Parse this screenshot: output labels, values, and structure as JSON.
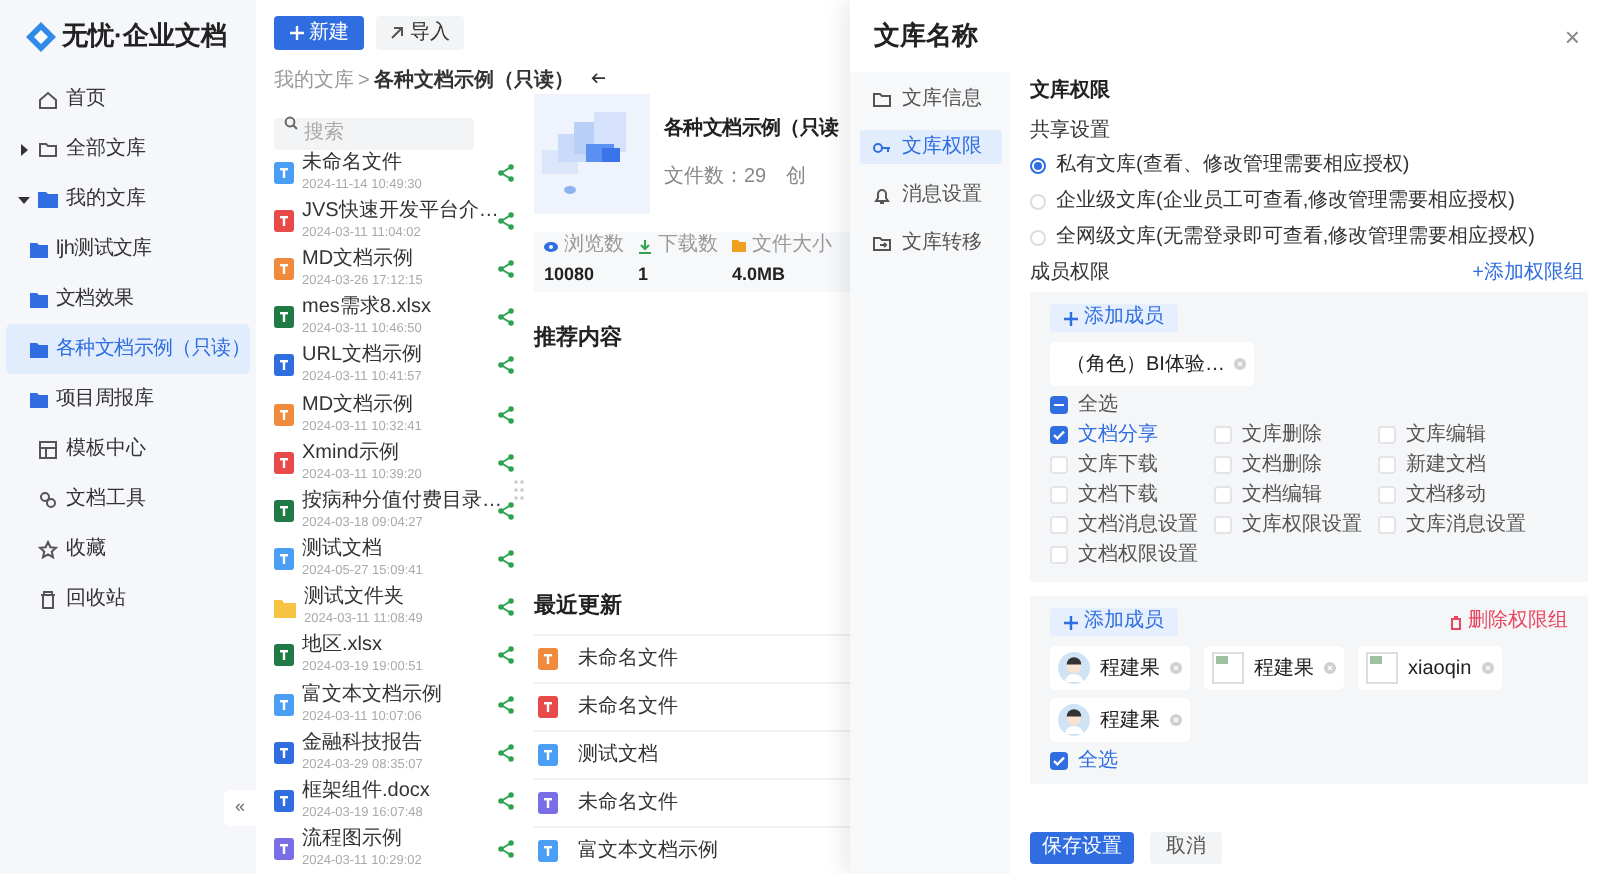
{
  "brand": {
    "name": "无忧·企业文档"
  },
  "sidebar": {
    "items": [
      {
        "label": "首页",
        "selected": false
      },
      {
        "label": "全部文库",
        "selected": false,
        "expanded": false
      },
      {
        "label": "我的文库",
        "selected": false,
        "expanded": true,
        "children": [
          {
            "label": "ljh测试文库",
            "selected": false
          },
          {
            "label": "文档效果",
            "selected": false
          },
          {
            "label": "各种文档示例（只读）",
            "selected": true
          },
          {
            "label": "项目周报库",
            "selected": false
          }
        ]
      },
      {
        "label": "模板中心",
        "selected": false
      },
      {
        "label": "文档工具",
        "selected": false
      },
      {
        "label": "收藏",
        "selected": false
      },
      {
        "label": "回收站",
        "selected": false
      }
    ],
    "collapse": "«"
  },
  "toolbar": {
    "new_button": "新建",
    "import_button": "导入"
  },
  "breadcrumb": {
    "parent": "我的文库",
    "separator": ">",
    "current": "各种文档示例（只读）"
  },
  "search": {
    "placeholder": "搜索"
  },
  "files": [
    {
      "kind": "doc",
      "name": "未命名文件",
      "time": "2024-11-14 10:49:30"
    },
    {
      "kind": "pdf",
      "name": "JVS快速开发平台介…",
      "time": "2024-03-11 11:04:02"
    },
    {
      "kind": "md",
      "name": "MD文档示例",
      "time": "2024-03-26 17:12:15"
    },
    {
      "kind": "excel",
      "name": "mes需求8.xlsx",
      "time": "2024-03-11 10:46:50"
    },
    {
      "kind": "url",
      "name": "URL文档示例",
      "time": "2024-03-11 10:41:57"
    },
    {
      "kind": "md",
      "name": "MD文档示例",
      "time": "2024-03-11 10:32:41"
    },
    {
      "kind": "xmind",
      "name": "Xmind示例",
      "time": "2024-03-11 10:39:20"
    },
    {
      "kind": "excel",
      "name": "按病种分值付费目录…",
      "time": "2024-03-18 09:04:27"
    },
    {
      "kind": "doc",
      "name": "测试文档",
      "time": "2024-05-27 15:09:41"
    },
    {
      "kind": "folder",
      "name": "测试文件夹",
      "time": "2024-03-11 11:08:49"
    },
    {
      "kind": "excel",
      "name": "地区.xlsx",
      "time": "2024-03-19 19:00:51"
    },
    {
      "kind": "doc",
      "name": "富文本文档示例",
      "time": "2024-03-11 10:07:06"
    },
    {
      "kind": "url",
      "name": "金融科技报告",
      "time": "2024-03-29 08:35:07"
    },
    {
      "kind": "word",
      "name": "框架组件.docx",
      "time": "2024-03-19 16:07:48"
    },
    {
      "kind": "flow",
      "name": "流程图示例",
      "time": "2024-03-11 10:29:02"
    }
  ],
  "library": {
    "title": "各种文档示例（只读",
    "file_count": "文件数：29",
    "created": "创",
    "stats": [
      {
        "kind": "views",
        "label": "浏览数",
        "value": "10080"
      },
      {
        "kind": "downloads",
        "label": "下载数",
        "value": "1"
      },
      {
        "kind": "size",
        "label": "文件大小",
        "value": "4.0MB"
      }
    ]
  },
  "recommended": {
    "title": "推荐内容"
  },
  "recent": {
    "title": "最近更新",
    "items": [
      {
        "kind": "md",
        "name": "未命名文件"
      },
      {
        "kind": "xmind",
        "name": "未命名文件"
      },
      {
        "kind": "doc",
        "name": "测试文档"
      },
      {
        "kind": "flow",
        "name": "未命名文件"
      },
      {
        "kind": "doc",
        "name": "富文本文档示例"
      }
    ]
  },
  "drawer": {
    "title": "文库名称",
    "close": "×",
    "tabs": [
      {
        "label": "文库信息",
        "selected": false
      },
      {
        "label": "文库权限",
        "selected": true
      },
      {
        "label": "消息设置",
        "selected": false
      },
      {
        "label": "文库转移",
        "selected": false
      }
    ],
    "section_title": "文库权限",
    "sharing": {
      "label": "共享设置",
      "options": [
        {
          "label": "私有文库(查看、修改管理需要相应授权)",
          "selected": true
        },
        {
          "label": "企业级文库(企业员工可查看,修改管理需要相应授权)",
          "selected": false
        },
        {
          "label": "全网级文库(无需登录即可查看,修改管理需要相应授权)",
          "selected": false
        }
      ]
    },
    "members": {
      "label": "成员权限",
      "add_group": "+添加权限组",
      "groups": [
        {
          "add_member": "添加成员",
          "members": [
            {
              "kind": "role",
              "name": "（角色）BI体验…"
            }
          ],
          "select_all": {
            "label": "全选",
            "indeterminate": true
          },
          "permissions": [
            {
              "label": "文档分享",
              "checked": true
            },
            {
              "label": "文库删除",
              "checked": false
            },
            {
              "label": "文库编辑",
              "checked": false
            },
            {
              "label": "文库下载",
              "checked": false
            },
            {
              "label": "文档删除",
              "checked": false
            },
            {
              "label": "新建文档",
              "checked": false
            },
            {
              "label": "文档下载",
              "checked": false
            },
            {
              "label": "文档编辑",
              "checked": false
            },
            {
              "label": "文档移动",
              "checked": false
            },
            {
              "label": "文档消息设置",
              "checked": false
            },
            {
              "label": "文库权限设置",
              "checked": false
            },
            {
              "label": "文库消息设置",
              "checked": false
            },
            {
              "label": "文档权限设置",
              "checked": false
            }
          ]
        },
        {
          "add_member": "添加成员",
          "delete_group": "删除权限组",
          "members": [
            {
              "kind": "avatar",
              "name": "程建果"
            },
            {
              "kind": "broken",
              "name": "程建果"
            },
            {
              "kind": "broken",
              "name": "xiaoqin"
            },
            {
              "kind": "avatar",
              "name": "程建果"
            }
          ],
          "select_all": {
            "label": "全选",
            "checked": true
          }
        }
      ]
    },
    "save_button": "保存设置",
    "cancel_button": "取消"
  }
}
